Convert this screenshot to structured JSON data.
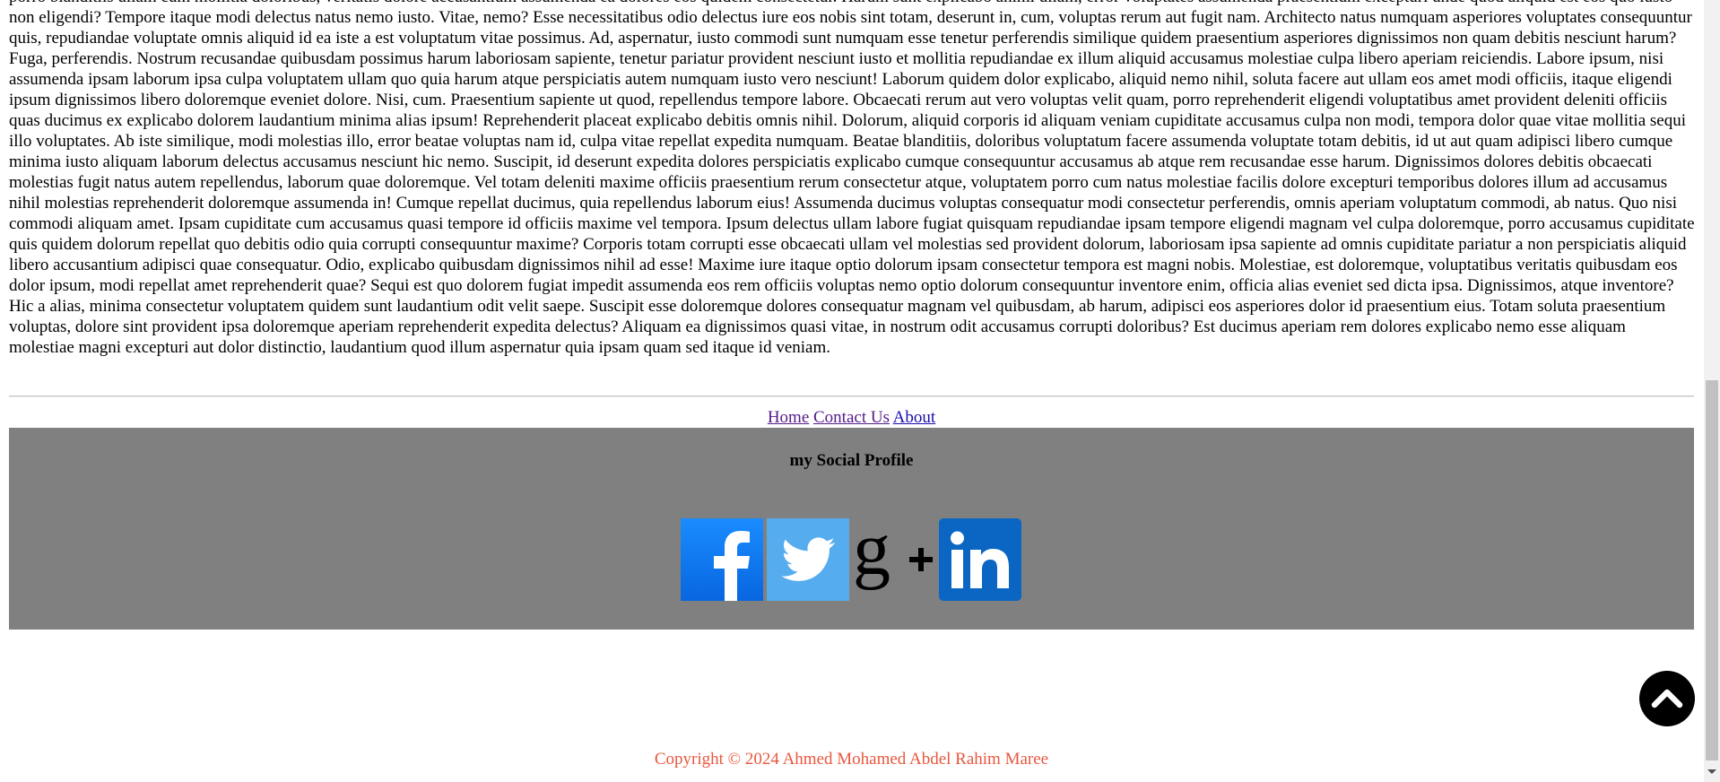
{
  "article": {
    "body": "porro blanditiis ullam cum mollitia doloribus, veritatis dolore accusantium assumenda ea dolores eos quidem consectetur. Harum sunt explicabo animi ullam, error voluptates assumenda praesentium excepturi unde quod aliquid est eos quo iusto non eligendi? Tempore itaque modi delectus natus nemo iusto. Vitae, nemo? Esse necessitatibus odio delectus iure eos nobis sint totam, deserunt in, cum, voluptas rerum aut fugit nam. Architecto natus numquam asperiores voluptates consequuntur quis, repudiandae voluptate omnis aliquid id ea iste a est voluptatum vitae possimus. Ad, aspernatur, iusto commodi sunt numquam esse tenetur perferendis similique quidem praesentium asperiores dignissimos non quam debitis nesciunt harum? Fuga, perferendis. Nostrum recusandae quibusdam possimus harum laboriosam sapiente, tenetur pariatur provident nesciunt iusto et mollitia repudiandae ex illum aliquid accusamus molestiae culpa libero aperiam reiciendis. Labore ipsum, nisi assumenda ipsam laborum ipsa culpa voluptatem ullam quo quia harum atque perspiciatis autem numquam iusto vero nesciunt! Laborum quidem dolor explicabo, aliquid nemo nihil, soluta facere aut ullam eos amet modi officiis, itaque eligendi ipsum dignissimos libero doloremque eveniet dolore. Nisi, cum. Praesentium sapiente ut quod, repellendus tempore labore. Obcaecati rerum aut vero voluptas velit quam, porro reprehenderit eligendi voluptatibus amet provident deleniti officiis quas ducimus ex explicabo dolorem laudantium minima alias ipsum! Reprehenderit placeat explicabo debitis omnis nihil. Dolorum, aliquid corporis id aliquam veniam cupiditate accusamus culpa non modi, tempora dolor quae vitae mollitia sequi illo voluptates. Ab iste similique, modi molestias illo, error beatae voluptas nam id, culpa vitae repellat expedita numquam. Beatae blanditiis, doloribus voluptatum facere assumenda voluptate totam debitis, id ut aut quam adipisci libero cumque minima iusto aliquam laborum delectus accusamus nesciunt hic nemo. Suscipit, id deserunt expedita dolores perspiciatis explicabo cumque consequuntur accusamus ab atque rem recusandae esse harum. Dignissimos dolores debitis obcaecati molestias fugit natus autem repellendus, laborum quae doloremque. Vel totam deleniti maxime officiis praesentium rerum consectetur atque, voluptatem porro cum natus molestiae facilis dolore excepturi temporibus dolores illum ad accusamus nihil molestias reprehenderit doloremque assumenda in! Cumque repellat ducimus, quia repellendus laborum eius! Assumenda ducimus voluptas consequatur modi consectetur perferendis, omnis aperiam voluptatum commodi, ab natus. Quo nisi commodi aliquam amet. Ipsam cupiditate cum accusamus quasi tempore id officiis maxime vel tempora. Ipsum delectus ullam labore fugiat quisquam repudiandae ipsam tempore eligendi magnam vel culpa doloremque, porro accusamus cupiditate quis quidem dolorum repellat quo debitis odio quia corrupti consequuntur maxime? Corporis totam corrupti esse obcaecati ullam vel molestias sed provident dolorum, laboriosam ipsa sapiente ad omnis cupiditate pariatur a non perspiciatis aliquid libero accusantium adipisci quae consequatur. Odio, explicabo quibusdam dignissimos nihil ad esse! Maxime iure itaque optio dolorum ipsam consectetur tempora est magni nobis. Molestiae, est doloremque, voluptatibus veritatis quibusdam eos dolor ipsum, modi repellat amet reprehenderit quae? Sequi est quo dolorem fugiat impedit assumenda eos rem officiis voluptas nemo optio dolorum consequuntur inventore enim, officia alias eveniet sed dicta ipsa. Dignissimos, atque inventore? Hic a alias, minima consectetur voluptatem quidem sunt laudantium odit velit saepe. Suscipit esse doloremque dolores consequatur magnam vel quibusdam, ab harum, adipisci eos asperiores dolor id praesentium eius. Totam soluta praesentium voluptas, dolore sint provident ipsa doloremque aperiam reprehenderit expedita delectus? Aliquam ea dignissimos quasi vitae, in nostrum odit accusamus corrupti doloribus? Est ducimus aperiam rem dolores explicabo nemo esse aliquam molestiae magni excepturi aut dolor distinctio, laudantium quod illum aspernatur quia ipsam quam sed itaque id veniam."
  },
  "footer_nav": {
    "links": [
      {
        "label": "Home"
      },
      {
        "label": "Contact Us"
      },
      {
        "label": "About"
      }
    ]
  },
  "social": {
    "title": "my Social Profile",
    "icons": [
      {
        "name": "facebook-icon",
        "color": "#1877f2"
      },
      {
        "name": "twitter-icon",
        "color": "#55acee"
      },
      {
        "name": "google-plus-icon",
        "color": "#000000"
      },
      {
        "name": "linkedin-icon",
        "color": "#0a66c2"
      }
    ],
    "box_color": "#808080"
  },
  "copyright": {
    "text": "Copyright © 2024 Ahmed Mohamed Abdel Rahim Maree",
    "color": "#e8573f"
  },
  "back_to_top": {
    "icon": "chevron-up-icon"
  }
}
